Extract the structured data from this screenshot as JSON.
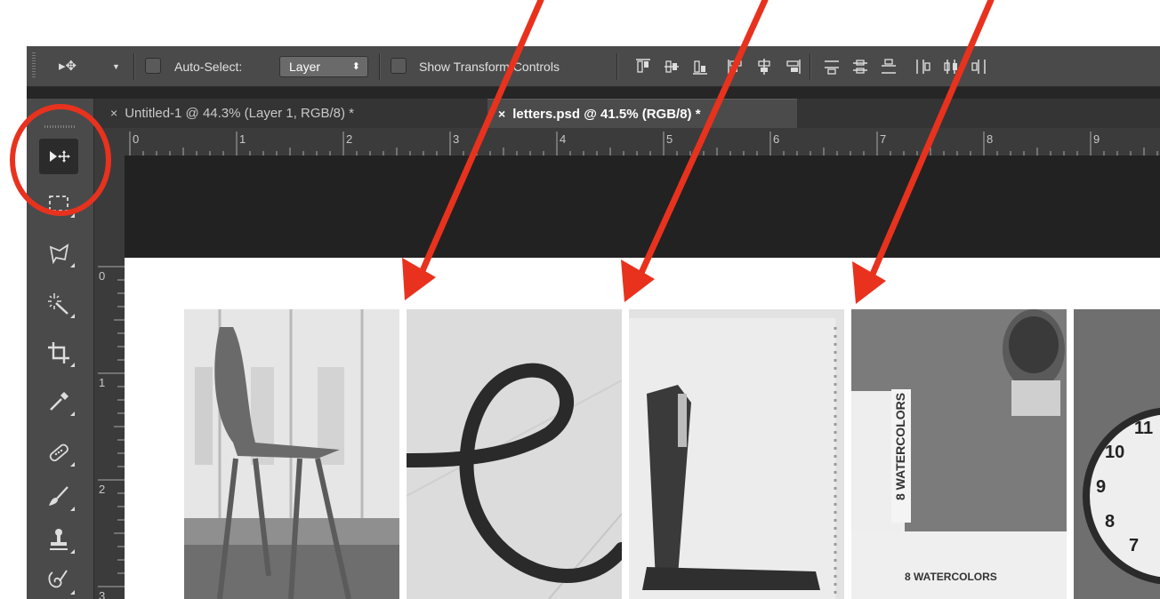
{
  "options_bar": {
    "auto_select_label": "Auto-Select:",
    "auto_select_value": "Layer",
    "show_transform_label": "Show Transform Controls"
  },
  "tabs": [
    {
      "close": "×",
      "label": "Untitled-1 @ 44.3% (Layer 1, RGB/8) *"
    },
    {
      "close": "×",
      "label": "letters.psd @ 41.5% (RGB/8) *"
    }
  ],
  "ruler": {
    "top": [
      "0",
      "1",
      "2",
      "3",
      "4",
      "5",
      "6",
      "7",
      "8",
      "9"
    ],
    "left": [
      "0",
      "1",
      "2",
      "3"
    ]
  },
  "photos": {
    "letter_e_text": "e",
    "clock_numbers": [
      "10",
      "11",
      "9",
      "8",
      "7"
    ],
    "watercolor_text": "8 WATERCOLORS"
  },
  "annotation": {
    "arrow_color": "#e8321e",
    "circle_color": "#e8321e"
  }
}
